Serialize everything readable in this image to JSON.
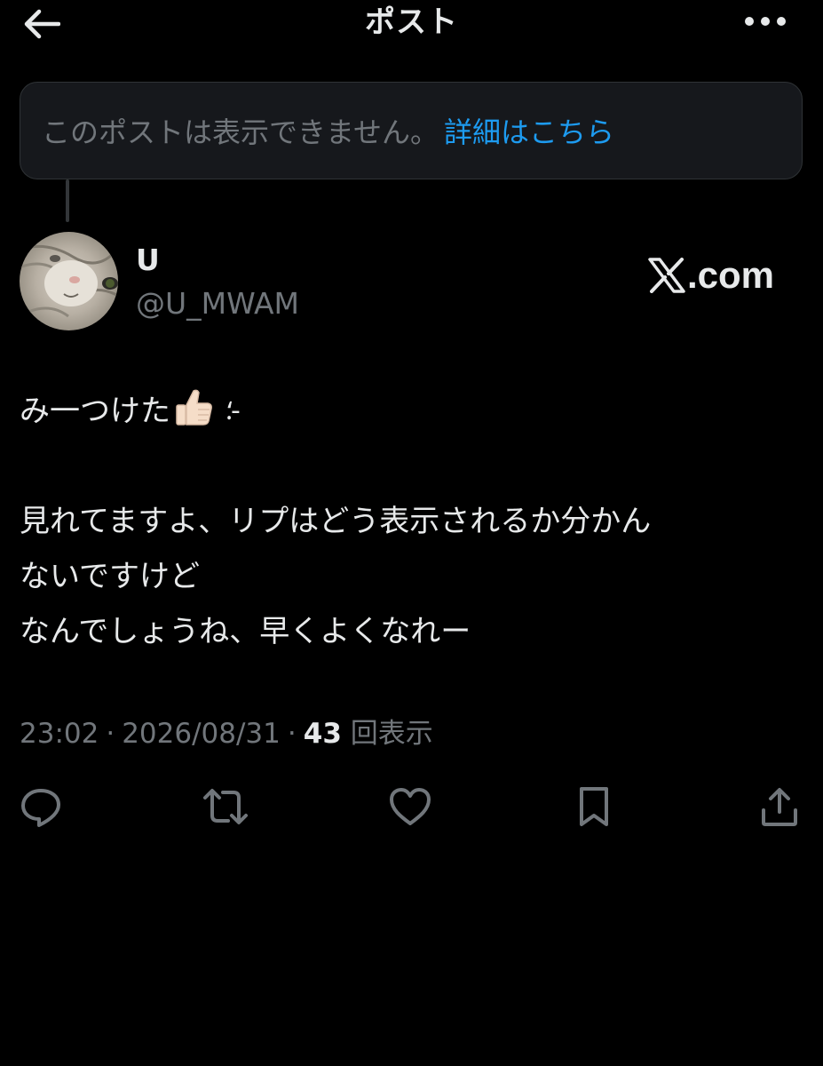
{
  "header": {
    "title": "ポスト",
    "back_icon": "arrow-left-icon",
    "more_icon": "more-horizontal-icon"
  },
  "notice": {
    "text": "このポストは表示できません。",
    "link_label": "詳細はこちら"
  },
  "author": {
    "display_name": "U",
    "handle": "@U_MWAM",
    "avatar_icon": "cat-avatar"
  },
  "watermark": {
    "text": ".com",
    "logo_icon": "x-logo-icon"
  },
  "post": {
    "line1": "み一つけた",
    "line1_emoji": "thumbs-up-icon",
    "line1_suffix": "⸵-",
    "line2": "見れてますよ、リプはどう表示されるか分かん",
    "line3": "ないですけど",
    "line4": "なんでしょうね、早くよくなれー"
  },
  "meta": {
    "time": "23:02",
    "separator": "·",
    "date": "2026/08/31",
    "views_count": "43",
    "views_label": "回表示"
  },
  "actions": {
    "reply_icon": "reply-icon",
    "repost_icon": "repost-icon",
    "like_icon": "heart-icon",
    "bookmark_icon": "bookmark-icon",
    "share_icon": "share-icon"
  },
  "colors": {
    "background": "#000000",
    "text_primary": "#e7e9ea",
    "text_secondary": "#71767b",
    "link": "#1d9bf0",
    "notice_bg": "#16181c",
    "border": "#2f3336"
  }
}
